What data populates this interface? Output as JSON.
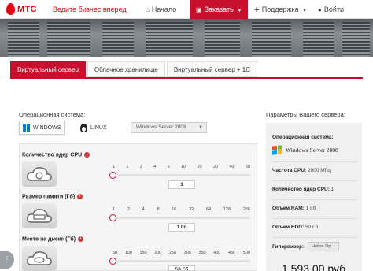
{
  "brand": {
    "name": "МТС",
    "slogan": "Ведите бизнес вперед",
    "color": "#e30611"
  },
  "nav": {
    "home": "Начало",
    "order": "Заказать",
    "support": "Поддержка",
    "login": "Войти"
  },
  "tabs": [
    "Виртуальный сервер",
    "Облачное хранилище",
    "Виртуальный сервер + 1С"
  ],
  "os": {
    "label": "Операционная система:",
    "windows": "WINDOWS",
    "linux": "LINUX",
    "selected_version": "Windows Server 2008"
  },
  "params": {
    "cpu": {
      "label": "Количество ядер CPU",
      "ticks": [
        "1",
        "2",
        "3",
        "4",
        "5",
        "10",
        "20",
        "30",
        "40",
        "50"
      ],
      "value": "1",
      "level": 0
    },
    "ram": {
      "label": "Размер памяти (Гб)",
      "ticks": [
        "1",
        "2",
        "4",
        "8",
        "16",
        "32",
        "64",
        "128",
        "256"
      ],
      "value": "1 Гб",
      "level": 0
    },
    "disk": {
      "label": "Место на диске (Гб)",
      "ticks": [
        "50",
        "100",
        "150",
        "200",
        "250",
        "300",
        "350",
        "400",
        "450",
        "500"
      ],
      "value": "50 Гб",
      "level": 0
    }
  },
  "summary": {
    "title": "Параметры Вашего сервера:",
    "os_label": "Операционная система:",
    "os_value": "Windows Server 2008",
    "cpu_freq_label": "Частота CPU:",
    "cpu_freq_value": "2000 МГц",
    "cores_label": "Количество ядер CPU:",
    "cores_value": "1",
    "ram_label": "Объем RAM:",
    "ram_value": "1 Гб",
    "hdd_label": "Объем HDD:",
    "hdd_value": "50 Гб",
    "hypervisor_label": "Гипервизор:",
    "hypervisor_value": "Helion Op",
    "price": "1 593,00 руб."
  }
}
